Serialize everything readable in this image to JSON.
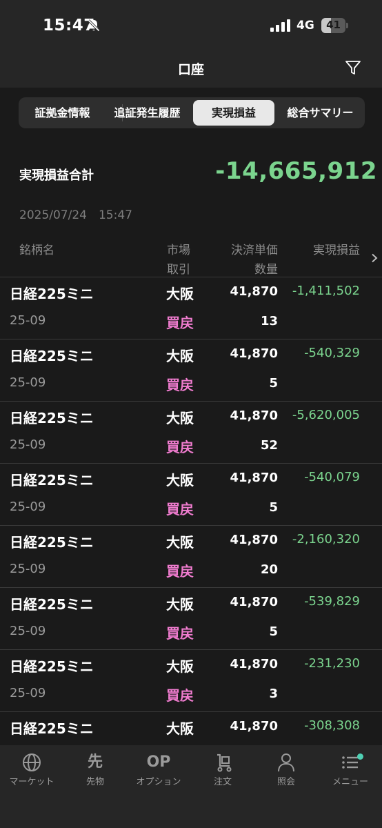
{
  "status_bar": {
    "time": "15:47",
    "network": "4G",
    "battery_level": "41",
    "battery_percent": 41
  },
  "header": {
    "title": "口座"
  },
  "tabs": [
    {
      "label": "証拠金情報",
      "active": false
    },
    {
      "label": "追証発生履歴",
      "active": false
    },
    {
      "label": "実現損益",
      "active": true
    },
    {
      "label": "総合サマリー",
      "active": false
    }
  ],
  "summary": {
    "label": "実現損益合計",
    "value": "-14,665,912",
    "timestamp": "2025/07/24　15:47"
  },
  "columns": {
    "name": "銘柄名",
    "market_1": "市場",
    "market_2": "取引",
    "price_1": "決済単価",
    "price_2": "数量",
    "pnl": "実現損益"
  },
  "rows": [
    {
      "name": "日経225ミニ",
      "exchange": "大阪",
      "price": "41,870",
      "pnl": "-1,411,502",
      "expiry": "25-09",
      "trade": "買戻",
      "qty": "13"
    },
    {
      "name": "日経225ミニ",
      "exchange": "大阪",
      "price": "41,870",
      "pnl": "-540,329",
      "expiry": "25-09",
      "trade": "買戻",
      "qty": "5"
    },
    {
      "name": "日経225ミニ",
      "exchange": "大阪",
      "price": "41,870",
      "pnl": "-5,620,005",
      "expiry": "25-09",
      "trade": "買戻",
      "qty": "52"
    },
    {
      "name": "日経225ミニ",
      "exchange": "大阪",
      "price": "41,870",
      "pnl": "-540,079",
      "expiry": "25-09",
      "trade": "買戻",
      "qty": "5"
    },
    {
      "name": "日経225ミニ",
      "exchange": "大阪",
      "price": "41,870",
      "pnl": "-2,160,320",
      "expiry": "25-09",
      "trade": "買戻",
      "qty": "20"
    },
    {
      "name": "日経225ミニ",
      "exchange": "大阪",
      "price": "41,870",
      "pnl": "-539,829",
      "expiry": "25-09",
      "trade": "買戻",
      "qty": "5"
    },
    {
      "name": "日経225ミニ",
      "exchange": "大阪",
      "price": "41,870",
      "pnl": "-231,230",
      "expiry": "25-09",
      "trade": "買戻",
      "qty": "3"
    },
    {
      "name": "日経225ミニ",
      "exchange": "大阪",
      "price": "41,870",
      "pnl": "-308,308",
      "expiry": "",
      "trade": "",
      "qty": ""
    }
  ],
  "bottom_nav": {
    "market": {
      "label": "マーケット",
      "icon": "globe-icon"
    },
    "futures": {
      "label": "先物",
      "icon_text": "先"
    },
    "options": {
      "label": "オプション",
      "icon_text": "OP"
    },
    "order": {
      "label": "注文",
      "icon": "cart-icon"
    },
    "account": {
      "label": "照会",
      "icon": "person-icon"
    },
    "menu": {
      "label": "メニュー",
      "icon": "list-icon"
    }
  },
  "colors": {
    "background": "#1a1a1a",
    "bar": "#262626",
    "positive_green": "#7bd48e",
    "trade_pink": "#f07ccf",
    "muted": "#8c8c8c",
    "badge_teal": "#4fd0b4"
  }
}
